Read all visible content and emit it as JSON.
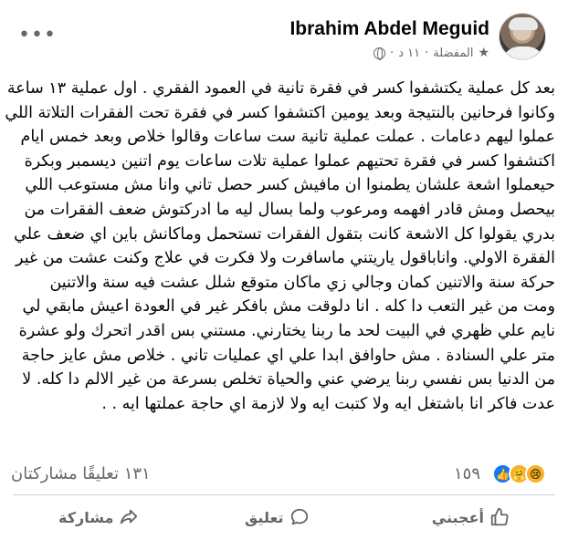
{
  "post": {
    "author": "Ibrahim Abdel Meguid",
    "meta_time": "١١ د",
    "meta_favorites": "المفضلة",
    "meta_sep": "·",
    "body_lines": [
      "بعد كل عملية يكتشفوا كسر في فقرة تانية في العمود الفقري . اول عملية ١٣ ساعة",
      "وكانوا فرحانين بالنتيجة وبعد يومين اكتشفوا كسر في فقرة تحت الفقرات التلاتة اللي",
      "عملوا ليهم دعامات . عملت عملية تانية ست ساعات وقالوا خلاص وبعد خمس ايام",
      "اكتشفوا كسر في فقرة تحتيهم عملوا عملية تلات ساعات يوم اتنين ديسمبر وبكرة",
      "حيعملوا اشعة علشان يطمنوا ان مافيش كسر حصل تاني وانا مش مستوعب اللي",
      "بيحصل ومش قادر افهمه ومرعوب  ولما بسال ليه ما ادركتوش ضعف الفقرات من",
      "بدري يقولوا كل الاشعة كانت بتقول الفقرات تستحمل وماكانش باين اي ضعف علي",
      "الفقرة الاولي. واناباقول ياريتني ماسافرت ولا فكرت في علاج وكنت عشت من غير",
      "حركة سنة والاتنين كمان وجالي زي ماكان متوقع شلل عشت فيه سنة والاتنين",
      "ومت من غير التعب دا كله . انا دلوقت مش بافكر غير في العودة اعيش مابقي لي",
      "نايم علي ظهري في البيت لحد ما ربنا يختارني. مستني بس اقدر اتحرك ولو عشرة",
      "متر علي السنادة . مش حاوافق ابدا علي اي عمليات تاني . خلاص مش عايز حاجة",
      "من الدنيا بس نفسي ربنا يرضي عني والحياة تخلص بسرعة من غير الالم دا كله. لا",
      "عدت فاكر انا باشتغل ايه ولا كتبت ايه ولا لازمة اي حاجة عملتها ايه .  ."
    ]
  },
  "reactions": {
    "count": "١٥٩",
    "comments_shares": "١٣١ تعليقًا مشاركتان",
    "icons": [
      "like-icon",
      "care-icon",
      "sad-icon"
    ],
    "like_color": "#1877f2",
    "emoji_color": "#f7b125"
  },
  "actions": {
    "like": "أعجبني",
    "comment": "تعليق",
    "share": "مشاركة"
  },
  "colors": {
    "text": "#050505",
    "secondary": "#65676b",
    "divider": "#ced0d4"
  }
}
